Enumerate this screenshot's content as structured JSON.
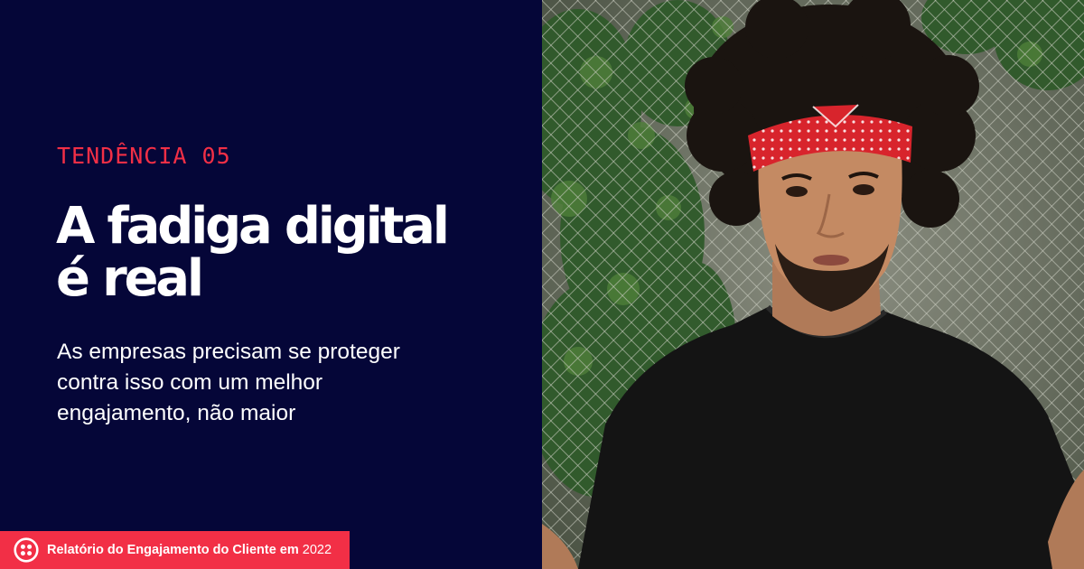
{
  "eyebrow": "TENDÊNCIA 05",
  "headline": {
    "line1": "A fadiga digital",
    "line2": "é real"
  },
  "subhead": {
    "line1": "As empresas precisam se proteger",
    "line2": "contra isso com um melhor",
    "line3": "engajamento, não maior"
  },
  "footer": {
    "report_title": "Relatório do Engajamento do Cliente em",
    "year": "2022",
    "logo_icon": "twilio-logo-icon"
  },
  "colors": {
    "background": "#050638",
    "accent": "#f22f46",
    "text": "#ffffff"
  }
}
